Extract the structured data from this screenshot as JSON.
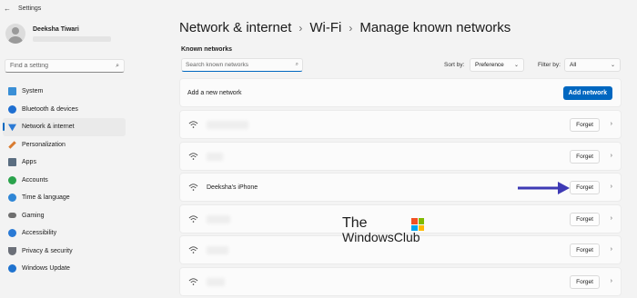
{
  "window": {
    "title": "Settings"
  },
  "user": {
    "name": "Deeksha Tiwari"
  },
  "search": {
    "placeholder": "Find a setting"
  },
  "sidebar": {
    "items": [
      {
        "label": "System",
        "icon": "system-icon"
      },
      {
        "label": "Bluetooth & devices",
        "icon": "bluetooth-icon"
      },
      {
        "label": "Network & internet",
        "icon": "network-icon",
        "active": true
      },
      {
        "label": "Personalization",
        "icon": "brush-icon"
      },
      {
        "label": "Apps",
        "icon": "apps-icon"
      },
      {
        "label": "Accounts",
        "icon": "accounts-icon"
      },
      {
        "label": "Time & language",
        "icon": "clock-globe-icon"
      },
      {
        "label": "Gaming",
        "icon": "gamepad-icon"
      },
      {
        "label": "Accessibility",
        "icon": "accessibility-icon"
      },
      {
        "label": "Privacy & security",
        "icon": "shield-icon"
      },
      {
        "label": "Windows Update",
        "icon": "update-icon"
      }
    ]
  },
  "breadcrumb": {
    "items": [
      "Network & internet",
      "Wi-Fi",
      "Manage known networks"
    ],
    "separator": "›"
  },
  "main": {
    "section_label": "Known networks",
    "search_placeholder": "Search known networks",
    "sort_label": "Sort by:",
    "sort_value": "Preference",
    "filter_label": "Filter by:",
    "filter_value": "All",
    "add_row_label": "Add a new network",
    "add_button": "Add network",
    "forget_label": "Forget",
    "networks": [
      {
        "name": ""
      },
      {
        "name": ""
      },
      {
        "name": "Deeksha's iPhone"
      },
      {
        "name": ""
      },
      {
        "name": ""
      },
      {
        "name": ""
      }
    ]
  },
  "watermark": {
    "line1": "The",
    "line2": "WindowsClub"
  },
  "colors": {
    "accent": "#0067c0",
    "arrow": "#3e3ab5"
  }
}
